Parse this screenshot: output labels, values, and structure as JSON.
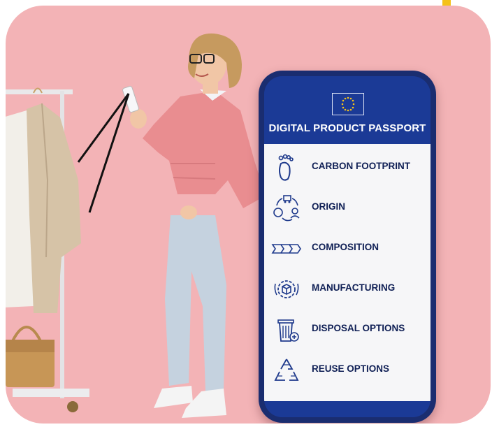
{
  "accent_colors": {
    "background_pink": "#f3b3b6",
    "eu_blue": "#1b3a96",
    "icon_navy": "#1f3a8c",
    "highlight_yellow": "#f4c21a"
  },
  "passport": {
    "title": "DIGITAL PRODUCT PASSPORT",
    "header_icon": "eu-flag-icon",
    "items": [
      {
        "label": "CARBON FOOTPRINT",
        "icon": "footprint-icon"
      },
      {
        "label": "ORIGIN",
        "icon": "origin-route-icon"
      },
      {
        "label": "COMPOSITION",
        "icon": "composition-chevrons-icon"
      },
      {
        "label": "MANUFACTURING",
        "icon": "manufacturing-gear-icon"
      },
      {
        "label": "DISPOSAL OPTIONS",
        "icon": "disposal-bin-icon"
      },
      {
        "label": "REUSE OPTIONS",
        "icon": "recycle-icon"
      }
    ]
  }
}
